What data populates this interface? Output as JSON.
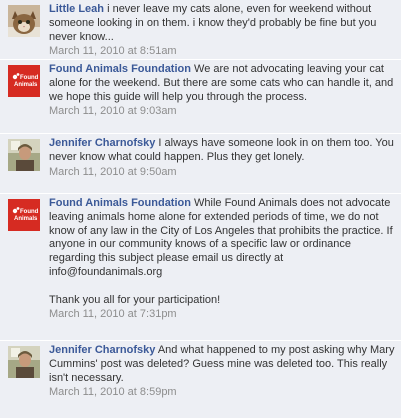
{
  "comments": [
    {
      "author": "Little Leah",
      "avatar_icon": "cat-photo-icon",
      "text": " i never leave my cats alone, even for weekend without someone looking in on them. i know they'd probably be fine but you never know...",
      "timestamp": "March 11, 2010 at 8:51am"
    },
    {
      "author": "Found Animals Foundation",
      "avatar_icon": "found-animals-logo-icon",
      "avatar_text": "Found Animals",
      "text": " We are not advocating leaving your cat alone for the weekend. But there are some cats who can handle it, and we hope this guide will help you through the process.",
      "timestamp": "March 11, 2010 at 9:03am"
    },
    {
      "author": "Jennifer Charnofsky",
      "avatar_icon": "person-photo-icon",
      "text": " I always have someone look in on them too. You never know what could happen. Plus they get lonely.",
      "timestamp": "March 11, 2010 at 9:50am"
    },
    {
      "author": "Found Animals Foundation",
      "avatar_icon": "found-animals-logo-icon",
      "avatar_text": "Found Animals",
      "text": " While Found Animals does not advocate leaving animals home alone for extended periods of time, we do not know of any law in the City of Los Angeles that prohibits the practice. If anyone in our community knows of a specific law or ordinance regarding this subject please email us directly at info@foundanimals.org\n\nThank you all for your participation!",
      "timestamp": "March 11, 2010 at 7:31pm"
    },
    {
      "author": "Jennifer Charnofsky",
      "avatar_icon": "person-photo-icon",
      "text": " And what happened to my post asking why Mary Cummins' post was deleted? Guess mine was deleted too. This really isn't necessary.",
      "timestamp": "March 11, 2010 at 8:59pm"
    }
  ],
  "colors": {
    "background": "#edeff4",
    "author_link": "#3b5998",
    "timestamp": "#8d8d8d",
    "logo_red": "#d62b22"
  }
}
